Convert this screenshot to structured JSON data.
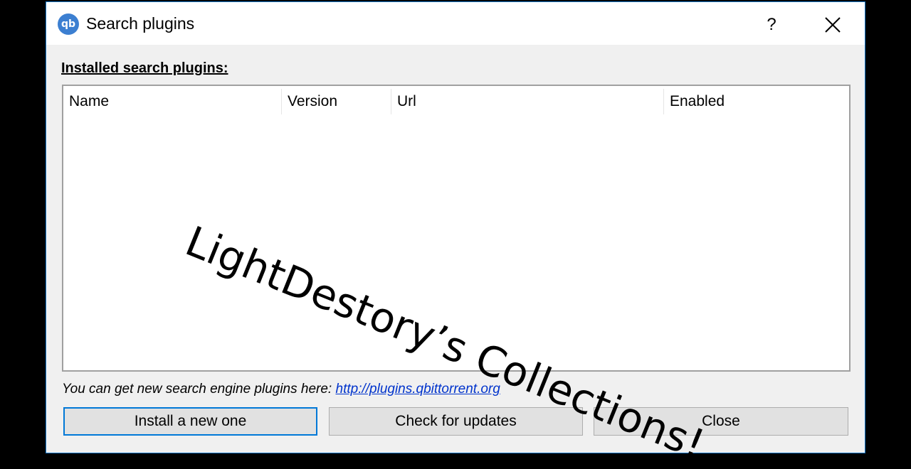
{
  "window": {
    "title": "Search plugins",
    "app_icon_text": "qb",
    "help_label": "?"
  },
  "section_label": "Installed search plugins:",
  "table": {
    "columns": [
      "Name",
      "Version",
      "Url",
      "Enabled"
    ],
    "rows": []
  },
  "watermark_text": "LightDestory’s Collections!",
  "hint": {
    "text": "You can get new search engine plugins here: ",
    "link": "http://plugins.qbittorrent.org"
  },
  "buttons": {
    "install": "Install a new one",
    "check": "Check for updates",
    "close": "Close"
  },
  "colors": {
    "accent": "#0078d7",
    "link": "#0033cc",
    "window_border": "#1979ca"
  }
}
